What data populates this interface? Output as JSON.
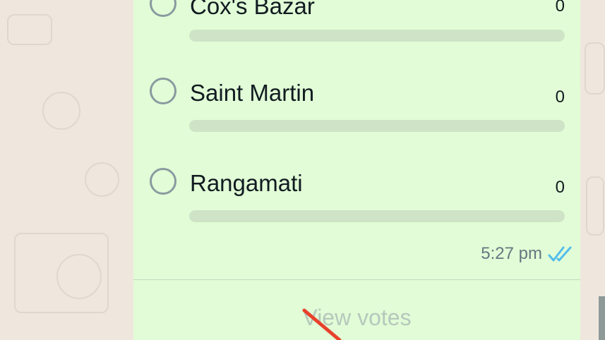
{
  "poll": {
    "options": [
      {
        "label": "Cox's Bazar",
        "count": "0",
        "progress": 0
      },
      {
        "label": "Saint Martin",
        "count": "0",
        "progress": 0
      },
      {
        "label": "Rangamati",
        "count": "0",
        "progress": 0
      }
    ],
    "timestamp": "5:27 pm",
    "read_status_icon": "double-check-icon",
    "view_votes_label": "View votes"
  },
  "colors": {
    "bubble": "#e1fcd6",
    "wallpaper": "#efe7de",
    "bar_track": "#cfe4c6",
    "read_ticks": "#53bdeb",
    "annotation_arrow": "#e8412c"
  }
}
